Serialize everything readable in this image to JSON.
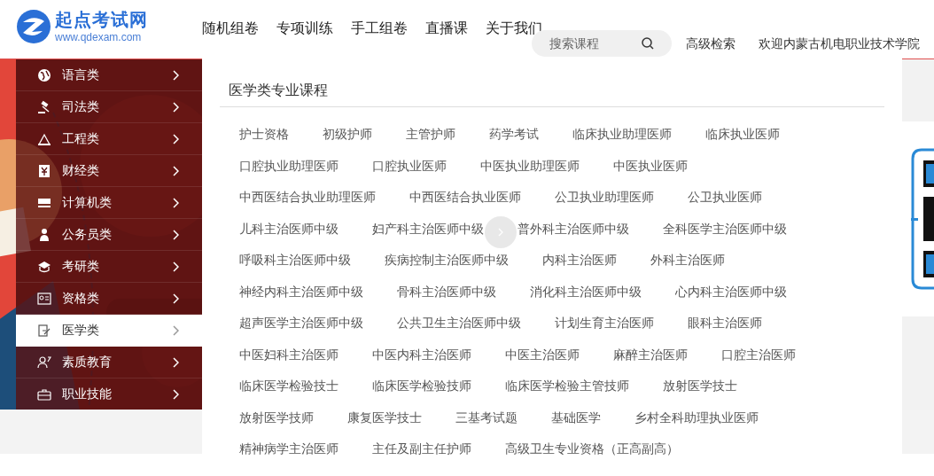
{
  "site": {
    "name": "起点考试网",
    "url": "www.qdexam.com"
  },
  "nav": [
    {
      "label": "随机组卷"
    },
    {
      "label": "专项训练"
    },
    {
      "label": "手工组卷"
    },
    {
      "label": "直播课"
    },
    {
      "label": "关于我们"
    }
  ],
  "search": {
    "placeholder": "搜索课程"
  },
  "advanced_search": "高级检索",
  "welcome": "欢迎内蒙古机电职业技术学院",
  "categories": [
    {
      "label": "语言类",
      "selected": false
    },
    {
      "label": "司法类",
      "selected": false
    },
    {
      "label": "工程类",
      "selected": false
    },
    {
      "label": "财经类",
      "selected": false
    },
    {
      "label": "计算机类",
      "selected": false
    },
    {
      "label": "公务员类",
      "selected": false
    },
    {
      "label": "考研类",
      "selected": false
    },
    {
      "label": "资格类",
      "selected": false
    },
    {
      "label": "医学类",
      "selected": true
    },
    {
      "label": "素质教育",
      "selected": false
    },
    {
      "label": "职业技能",
      "selected": false
    }
  ],
  "panel": {
    "title": "医学类专业课程",
    "courses": [
      "护士资格",
      "初级护师",
      "主管护师",
      "药学考试",
      "临床执业助理医师",
      "临床执业医师",
      "口腔执业助理医师",
      "口腔执业医师",
      "中医执业助理医师",
      "中医执业医师",
      "中西医结合执业助理医师",
      "中西医结合执业医师",
      "公卫执业助理医师",
      "公卫执业医师",
      "儿科主治医师中级",
      "妇产科主治医师中级",
      "普外科主治医师中级",
      "全科医学主治医师中级",
      "呼吸科主治医师中级",
      "疾病控制主治医师中级",
      "内科主治医师",
      "外科主治医师",
      "神经内科主治医师中级",
      "骨科主治医师中级",
      "消化科主治医师中级",
      "心内科主治医师中级",
      "超声医学主治医师中级",
      "公共卫生主治医师中级",
      "计划生育主治医师",
      "眼科主治医师",
      "中医妇科主治医师",
      "中医内科主治医师",
      "中医主治医师",
      "麻醉主治医师",
      "口腔主治医师",
      "临床医学检验技士",
      "临床医学检验技师",
      "临床医学检验主管技师",
      "放射医学技士",
      "放射医学技师",
      "康复医学技士",
      "三基考试题",
      "基础医学",
      "乡村全科助理执业医师",
      "精神病学主治医师",
      "主任及副主任护师",
      "高级卫生专业资格（正高副高）"
    ]
  }
}
